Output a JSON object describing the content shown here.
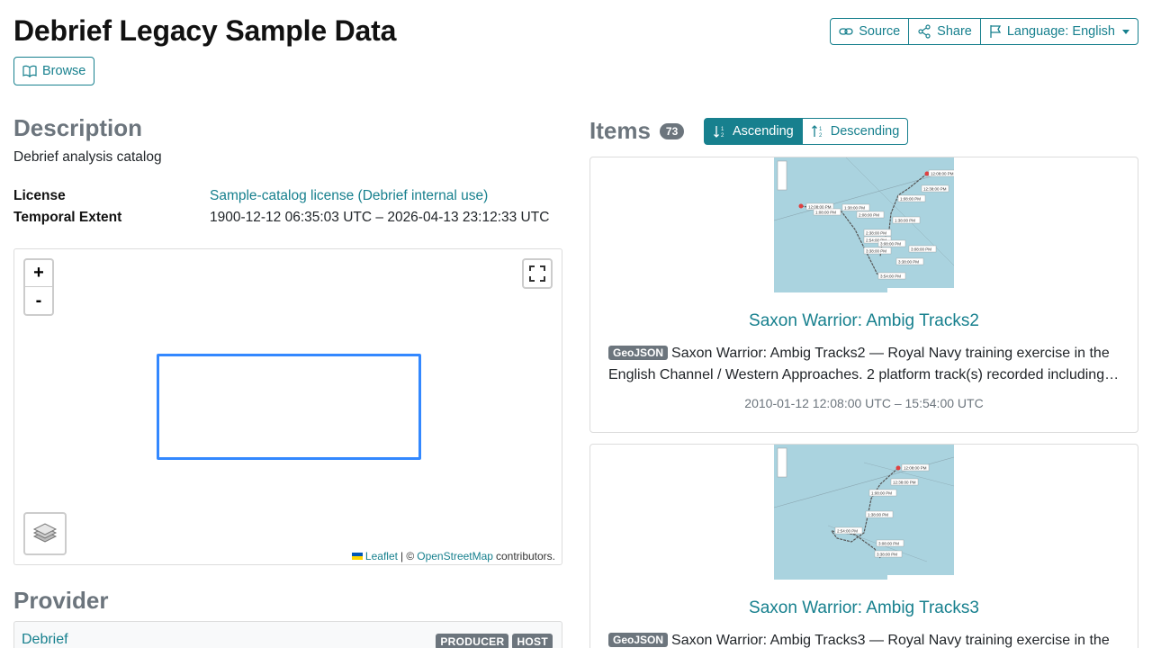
{
  "page": {
    "title": "Debrief Legacy Sample Data",
    "browse_label": "Browse"
  },
  "toolbar": {
    "source_label": "Source",
    "share_label": "Share",
    "language_label": "Language: English"
  },
  "description": {
    "heading": "Description",
    "text": "Debrief analysis catalog",
    "license_key": "License",
    "license_value": "Sample-catalog license (Debrief internal use)",
    "temporal_key": "Temporal Extent",
    "temporal_value": "1900-12-12 06:35:03 UTC – 2026-04-13 23:12:33 UTC"
  },
  "map": {
    "zoom_in": "+",
    "zoom_out": "-",
    "attribution_leaflet": "Leaflet",
    "attribution_sep": "| ©",
    "attribution_osm": "OpenStreetMap",
    "attribution_tail": "contributors.",
    "flag_colors": [
      "#0057b7",
      "#ffd700"
    ],
    "bbox_color": "#3388ff"
  },
  "provider": {
    "heading": "Provider",
    "name": "Debrief",
    "roles": [
      "PRODUCER",
      "HOST"
    ]
  },
  "items": {
    "heading": "Items",
    "count": "73",
    "sort_ascending": "Ascending",
    "sort_descending": "Descending",
    "list": [
      {
        "title": "Saxon Warrior: Ambig Tracks2",
        "format": "GeoJSON",
        "description": "Saxon Warrior: Ambig Tracks2 — Royal Navy training exercise in the English Channel / Western Approaches. 2 platform track(s) recorded including HMS Ambig and Contact Ambig over the exercise period.",
        "time": "2010-01-12 12:08:00 UTC – 15:54:00 UTC",
        "map_labels": [
          "12:08:00 PM",
          "12:38:00 PM",
          "1:08:00 PM",
          "12:08:00 PM",
          "1:08:00 PM",
          "1:38:00 PM",
          "2:08:00 PM",
          "1:38:00 PM",
          "2:38:00 PM",
          "2:54:00 PM",
          "3:08:00 PM",
          "3:08:00 PM",
          "3:38:00 PM",
          "3:38:00 PM",
          "3:54:00 PM"
        ]
      },
      {
        "title": "Saxon Warrior: Ambig Tracks3",
        "format": "GeoJSON",
        "description": "Saxon Warrior: Ambig Tracks3 — Royal Navy training exercise in the English Channel / Western Approaches.",
        "time": "",
        "map_labels": [
          "12:08:00 PM",
          "12:38:00 PM",
          "1:08:00 PM",
          "1:38:00 PM",
          "2:54:00 PM",
          "3:08:00 PM",
          "3:38:00 PM"
        ]
      }
    ]
  },
  "colors": {
    "accent": "#17808e",
    "muted": "#6c757d",
    "map_water": "#aad3df"
  }
}
